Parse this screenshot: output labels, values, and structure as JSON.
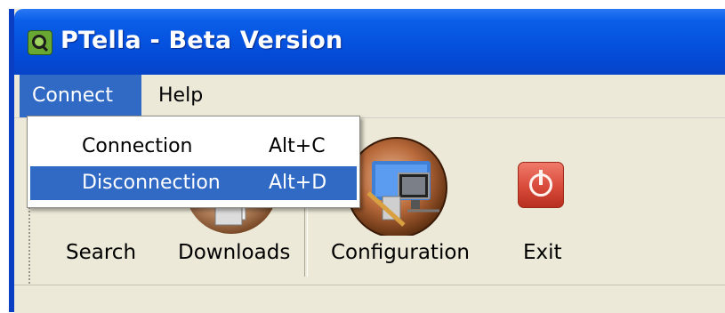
{
  "window": {
    "title": "PTella - Beta Version",
    "app_icon": "ptella-q-logo-icon"
  },
  "menubar": {
    "items": [
      {
        "label": "Connect"
      },
      {
        "label": "Help"
      }
    ]
  },
  "dropdown": {
    "items": [
      {
        "label": "Connection",
        "shortcut": "Alt+C"
      },
      {
        "label": "Disconnection",
        "shortcut": "Alt+D"
      }
    ]
  },
  "toolbar": {
    "buttons": [
      {
        "label": "Search",
        "icon": "search-icon"
      },
      {
        "label": "Downloads",
        "icon": "downloads-icon"
      },
      {
        "label": "Configuration",
        "icon": "configuration-icon"
      },
      {
        "label": "Exit",
        "icon": "exit-icon"
      }
    ]
  },
  "colors": {
    "titlebar": "#0553e0",
    "highlight": "#316ac5",
    "face": "#ece9d8"
  }
}
